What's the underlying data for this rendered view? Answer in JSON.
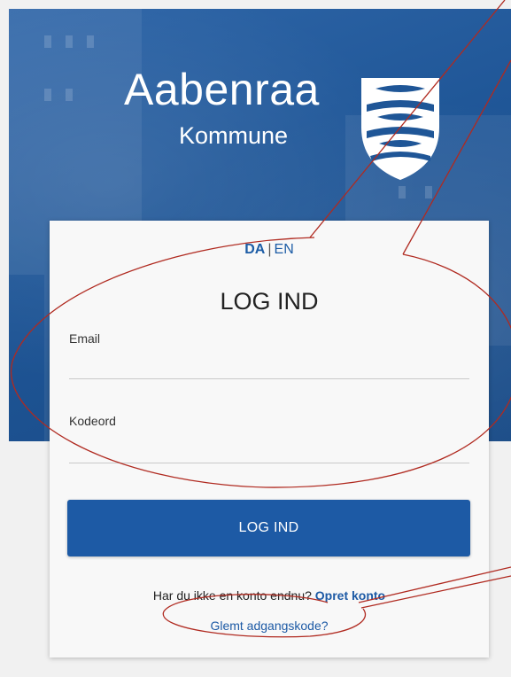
{
  "brand": {
    "name": "Aabenraa",
    "subtitle": "Kommune"
  },
  "language": {
    "current": "DA",
    "separator": "|",
    "other": "EN"
  },
  "form": {
    "title": "LOG IND",
    "email_label": "Email",
    "email_value": "",
    "password_label": "Kodeord",
    "password_value": "",
    "submit_label": "LOG IND"
  },
  "footer": {
    "signup_prompt": "Har du ikke en konto endnu?",
    "signup_link": "Opret konto",
    "forgot_link": "Glemt adgangskode?"
  },
  "colors": {
    "brand_blue": "#1d5aa5",
    "annotation_red": "#b02a20"
  }
}
